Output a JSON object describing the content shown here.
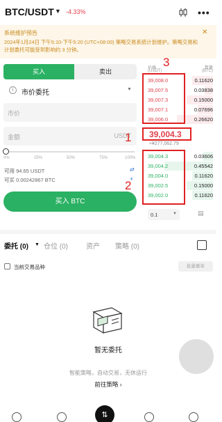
{
  "header": {
    "pair": "BTC/USDT",
    "change": "-4.33%",
    "icons": [
      "chart-candles-icon",
      "more-icon"
    ]
  },
  "notice": {
    "title": "系统维护预告",
    "body": "2024年1月24日 下午5:10-下午5:20 (UTC+08:00) 策略交易系统计划维护。策略交易和计划委托可能受到影响约 3 分钟。"
  },
  "trade": {
    "buy_tab": "买入",
    "sell_tab": "卖出",
    "order_type": "市价委托",
    "price_placeholder": "市价",
    "amount_placeholder": "金额",
    "amount_unit": "USDT",
    "slider_percent": 0,
    "ticks": [
      "0%",
      "25%",
      "50%",
      "75%",
      "100%"
    ],
    "available_usdt": "可用 94.65 USDT",
    "available_btc": "可买 0.00242867 BTC",
    "buy_button": "买入 BTC"
  },
  "orderbook": {
    "price_header": "价格",
    "price_unit": "(USDT)",
    "qty_header": "数量",
    "qty_unit": "(BTC)",
    "asks": [
      {
        "price": "39,008.0",
        "qty": "0.11620"
      },
      {
        "price": "39,007.5",
        "qty": "0.03838"
      },
      {
        "price": "39,007.3",
        "qty": "0.15000"
      },
      {
        "price": "39,007.1",
        "qty": "0.07696"
      },
      {
        "price": "39,006.0",
        "qty": "0.26620"
      }
    ],
    "last_price": "39,004.3",
    "last_fiat": "≈¥277,062.79",
    "bids": [
      {
        "price": "39,004.3",
        "qty": "0.03606"
      },
      {
        "price": "39,004.2",
        "qty": "0.45542"
      },
      {
        "price": "39,004.0",
        "qty": "0.11620"
      },
      {
        "price": "39,002.5",
        "qty": "0.15000"
      },
      {
        "price": "39,002.0",
        "qty": "0.11620"
      }
    ],
    "precision": "0.1"
  },
  "annotations": {
    "asks_label": "3",
    "mid_label": "1",
    "bids_label": "2"
  },
  "tabs": {
    "orders": "委托 (0)",
    "positions": "仓位 (0)",
    "assets": "资产",
    "strategies": "策略 (0)"
  },
  "filters": {
    "current_pair": "当前交易品种",
    "batch_cancel": "批量撤单"
  },
  "empty": {
    "title": "暂无委托",
    "subtitle": "智能策略，自动交易，无休运行",
    "link": "前往策略 ›"
  },
  "colors": {
    "green": "#2bb163",
    "red": "#e0414b",
    "annotation": "#e02020"
  }
}
